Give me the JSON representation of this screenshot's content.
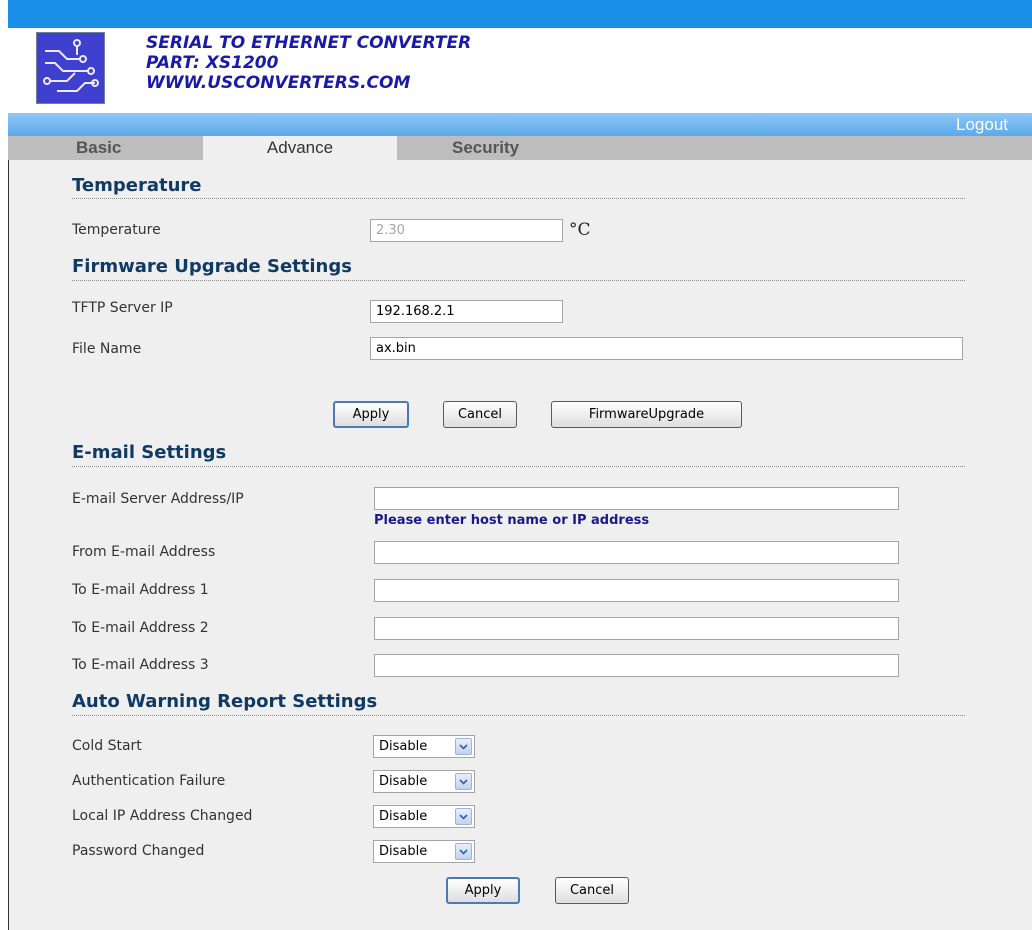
{
  "header": {
    "title_lines": [
      "SERIAL TO ETHERNET CONVERTER",
      "PART: XS1200",
      "WWW.USCONVERTERS.COM"
    ],
    "logout_label": "Logout",
    "logo_icon": "circuit-board-icon"
  },
  "tabs": [
    {
      "label": "Basic",
      "active": false
    },
    {
      "label": "Advance",
      "active": true
    },
    {
      "label": "Security",
      "active": false
    }
  ],
  "temperature": {
    "section_title": "Temperature",
    "label": "Temperature",
    "value": "2.30",
    "unit": "°C"
  },
  "firmware": {
    "section_title": "Firmware Upgrade Settings",
    "tftp_label": "TFTP Server IP",
    "tftp_value": "192.168.2.1",
    "file_label": "File Name",
    "file_value": "ax.bin",
    "apply_label": "Apply",
    "cancel_label": "Cancel",
    "upgrade_label": "FirmwareUpgrade"
  },
  "email": {
    "section_title": "E-mail Settings",
    "server_label": "E-mail Server Address/IP",
    "server_value": "",
    "server_hint": "Please enter host name or IP address",
    "from_label": "From E-mail Address",
    "from_value": "",
    "to1_label": "To E-mail Address 1",
    "to1_value": "",
    "to2_label": "To E-mail Address 2",
    "to2_value": "",
    "to3_label": "To E-mail Address 3",
    "to3_value": ""
  },
  "warning": {
    "section_title": "Auto Warning Report Settings",
    "rows": [
      {
        "label": "Cold Start",
        "value": "Disable"
      },
      {
        "label": "Authentication Failure",
        "value": "Disable"
      },
      {
        "label": "Local IP Address Changed",
        "value": "Disable"
      },
      {
        "label": "Password Changed",
        "value": "Disable"
      }
    ],
    "apply_label": "Apply",
    "cancel_label": "Cancel"
  },
  "colors": {
    "top_stripe": "#1a8fe8",
    "title_text": "#1a1aa8",
    "section_title": "#103a63",
    "hint_text": "#1a1a8c",
    "content_bg": "#efefef"
  }
}
